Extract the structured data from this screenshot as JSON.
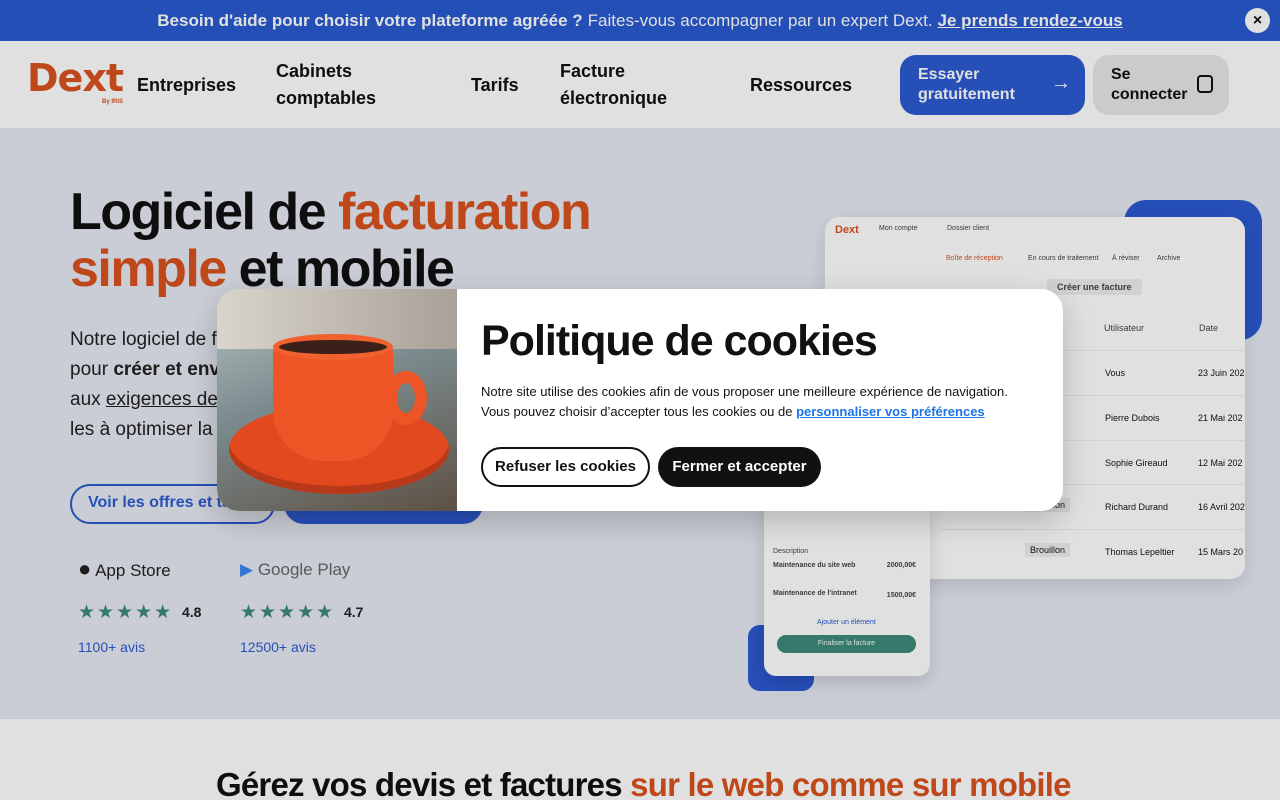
{
  "topbar": {
    "bold": "Besoin d'aide pour choisir votre plateforme agréée ?",
    "text": "Faites-vous accompagner par un expert Dext.",
    "link": "Je prends rendez-vous",
    "close": "×"
  },
  "header": {
    "logo": "Dext",
    "logo_sub": "By IRIS",
    "nav": [
      "Entreprises",
      "Cabinets comptables",
      "Tarifs",
      "Facture électronique",
      "Ressources"
    ],
    "try_label": "Essayer gratuitement",
    "login_label": "Se connecter"
  },
  "hero": {
    "title_a": "Logiciel de ",
    "title_b": "facturation",
    "title_c": "simple",
    "title_d": " et mobile",
    "para_1": "Notre logiciel de f",
    "para_2a": "pour ",
    "para_2b": "créer et envo",
    "para_3a": "aux ",
    "para_3b": "exigences de",
    "para_4": "les à optimiser la",
    "offers_button": "Voir les offres et tarifs",
    "appstore": {
      "name": "App Store",
      "stars": "★★★★★",
      "rating": "4.8",
      "reviews": "1100+ avis"
    },
    "googleplay": {
      "name": "Google Play",
      "stars": "★★★★★",
      "rating": "4.7",
      "reviews": "12500+ avis"
    }
  },
  "mock": {
    "account": "Mon compte",
    "client": "Dossier client",
    "tabs": [
      "Boîte de réception",
      "En cours de traitement",
      "À réviser",
      "Archive"
    ],
    "create": "Créer une facture",
    "col_user": "Utilisateur",
    "col_date": "Date",
    "rows": [
      {
        "user": "Vous",
        "date": "23 Juin 202"
      },
      {
        "user": "Pierre Dubois",
        "date": "21 Mai 202"
      },
      {
        "user": "Sophie Gireaud",
        "date": "12 Mai 202"
      },
      {
        "user": "Richard Durand",
        "date": "16 Avril 202",
        "status": "Brouillon"
      },
      {
        "user": "Thomas Lepeltier",
        "date": "15 Mars 20",
        "status": "Brouillon"
      }
    ],
    "phone_desc": "Description",
    "phone_item1": "Maintenance du site web",
    "phone_item1_amt": "2000,00€",
    "phone_item2": "Maintenance de l'intranet",
    "phone_item2_amt": "1500,00€",
    "phone_add": "Ajouter un élément",
    "phone_finish": "Finaliser la facture"
  },
  "bottom": {
    "title_a": "Gérez vos devis et factures ",
    "title_b": "sur le web comme sur mobile"
  },
  "cookie": {
    "title": "Politique de cookies",
    "text_1": "Notre site utilise des cookies afin de vous proposer une meilleure expérience de navigation.",
    "text_2": "Vous pouvez choisir d’accepter tous les cookies ou de ",
    "link": "personnaliser vos préférences",
    "refuse": "Refuser les cookies",
    "accept": "Fermer et accepter"
  },
  "colors": {
    "accent": "#2c5ad2",
    "brand": "#d9531e"
  }
}
